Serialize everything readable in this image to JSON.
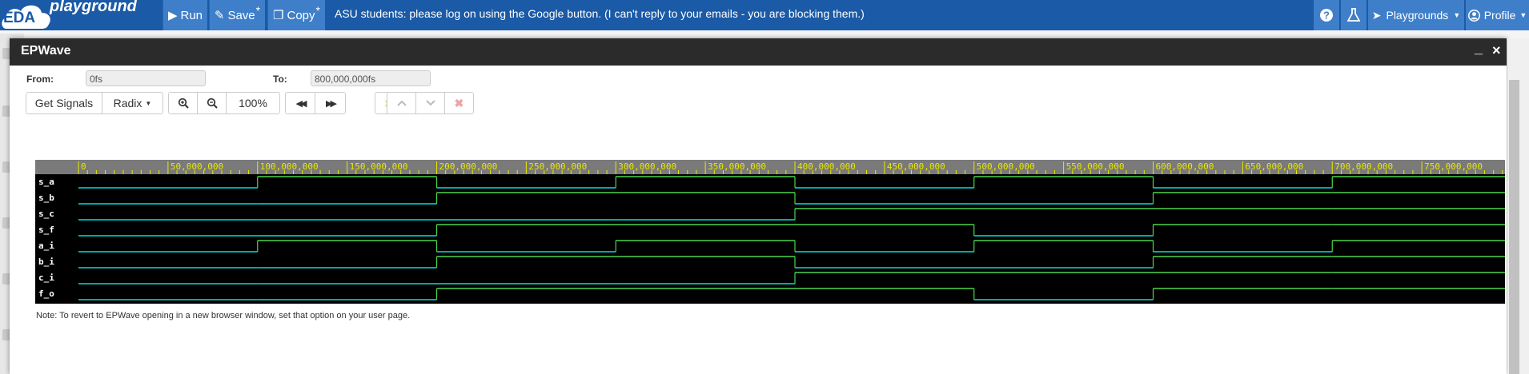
{
  "app": {
    "logo_left": "EDA",
    "logo_right": "playground"
  },
  "toolbar": {
    "run": "Run",
    "save": "Save",
    "copy": "Copy",
    "modified_mark": "*",
    "announcement": "ASU students: please log on using the Google button. (I can't reply to your emails - you are blocking them.)",
    "playgrounds": "Playgrounds",
    "profile": "Profile"
  },
  "colors": {
    "brand": "#1b5aa6",
    "button": "#3f7fc9",
    "signal_line": "#00e0e0",
    "signal_high": "#4cd64c",
    "ruler": "#e8e800"
  },
  "window": {
    "title": "EPWave"
  },
  "range": {
    "from_label": "From:",
    "from_value": "0fs",
    "to_label": "To:",
    "to_value": "800,000,000fs"
  },
  "controls": {
    "get_signals": "Get Signals",
    "radix": "Radix",
    "zoom": "100%"
  },
  "ruler": {
    "max": 800000000,
    "major_step": 50000000,
    "labels": [
      "0",
      "50,000,000",
      "100,000,000",
      "150,000,000",
      "200,000,000",
      "250,000,000",
      "300,000,000",
      "350,000,000",
      "400,000,000",
      "450,000,000",
      "500,000,000",
      "550,000,000",
      "600,000,000",
      "650,000,000",
      "700,000,000",
      "750,000,000"
    ]
  },
  "signals": [
    {
      "name": "s_a",
      "values": [
        0,
        1,
        0,
        1,
        0,
        1,
        0,
        1
      ]
    },
    {
      "name": "s_b",
      "values": [
        0,
        0,
        1,
        1,
        0,
        0,
        1,
        1
      ]
    },
    {
      "name": "s_c",
      "values": [
        0,
        0,
        0,
        0,
        1,
        1,
        1,
        1
      ]
    },
    {
      "name": "s_f",
      "values": [
        0,
        0,
        1,
        1,
        1,
        0,
        1,
        1
      ]
    },
    {
      "name": "a_i",
      "values": [
        0,
        1,
        0,
        1,
        0,
        1,
        0,
        1
      ]
    },
    {
      "name": "b_i",
      "values": [
        0,
        0,
        1,
        1,
        0,
        0,
        1,
        1
      ]
    },
    {
      "name": "c_i",
      "values": [
        0,
        0,
        0,
        0,
        1,
        1,
        1,
        1
      ]
    },
    {
      "name": "f_o",
      "values": [
        0,
        0,
        1,
        1,
        1,
        0,
        1,
        1
      ]
    }
  ],
  "signal_period": 100000000,
  "note": "Note: To revert to EPWave opening in a new browser window, set that option on your user page."
}
